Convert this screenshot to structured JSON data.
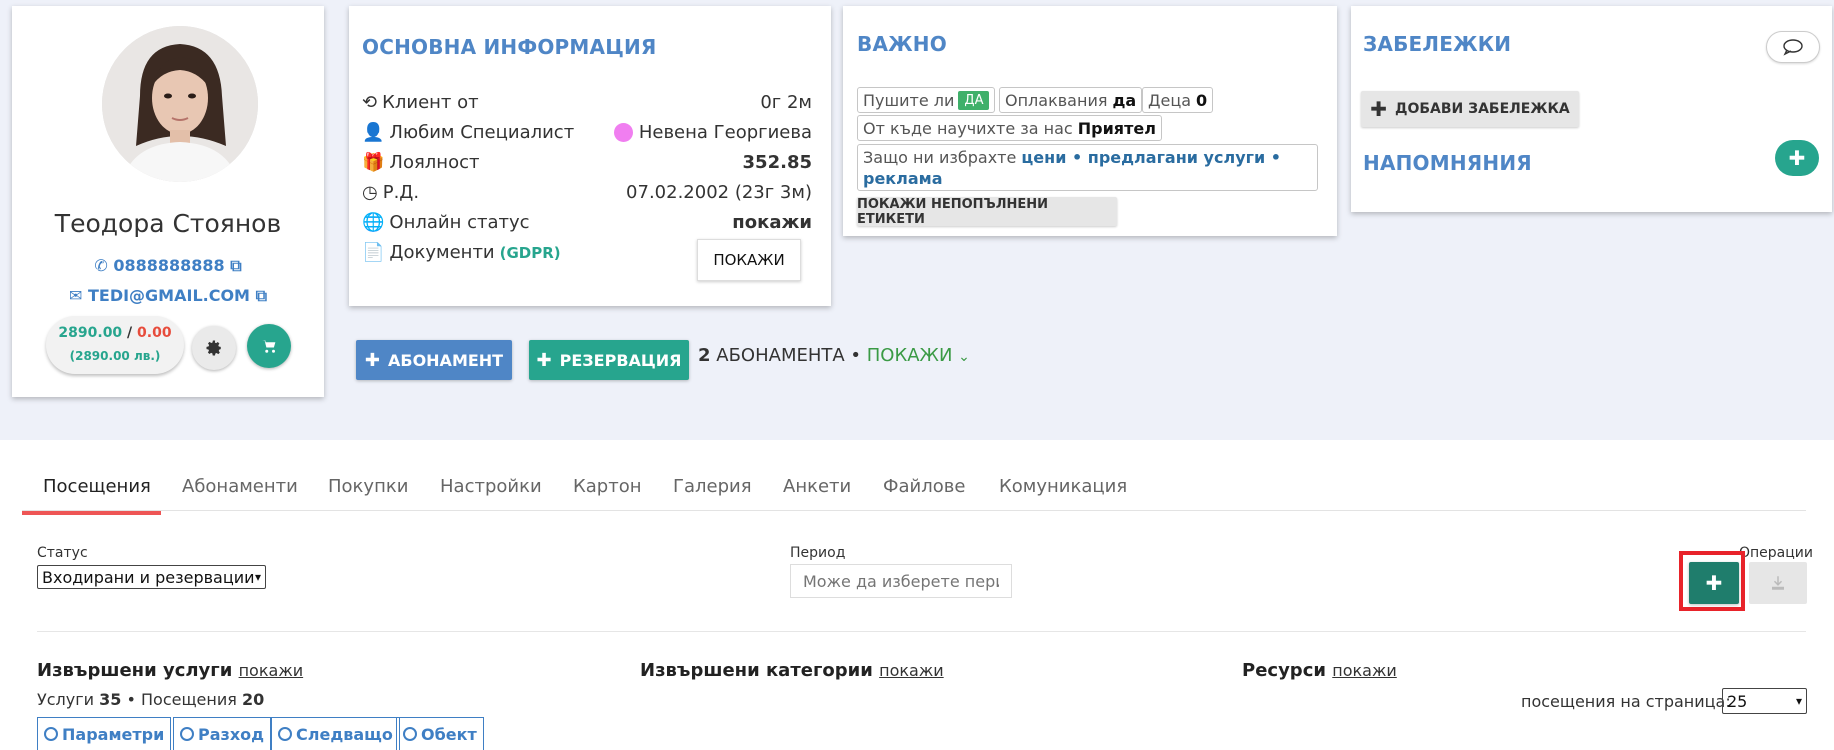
{
  "profile": {
    "name": "Теодора Стоянов",
    "phone": "0888888888",
    "email": "TEDI@GMAIL.COM",
    "balance_green": "2890.00",
    "balance_sep": " / ",
    "balance_red": "0.00",
    "balance_sub": "(2890.00 лв.)"
  },
  "basic_info": {
    "title": "ОСНОВНА ИНФОРМАЦИЯ",
    "rows": [
      {
        "label": "Клиент от",
        "value": "0г 2м"
      },
      {
        "label": "Любим Специалист",
        "value": "Невена Георгиева"
      },
      {
        "label": "Лоялност",
        "value": "352.85"
      },
      {
        "label": "Р.Д.",
        "value": "07.02.2002 (23г 3м)"
      },
      {
        "label": "Онлайн статус",
        "value": "покажи"
      },
      {
        "label": "Документи",
        "value": ""
      }
    ],
    "gdpr": "(GDPR)",
    "show_button": "ПОКАЖИ"
  },
  "important": {
    "title": "ВАЖНО",
    "smoke_label": "Пушите ли",
    "smoke_value": "ДА",
    "complaints_label": "Оплаквания",
    "complaints_value": "да",
    "kids_label": "Деца",
    "kids_value": "0",
    "source_label": "От къде научихте за нас",
    "source_value": "Приятел",
    "why_label": "Защо ни избрахте",
    "why_value_1": "цени • предлагани услуги •",
    "why_value_2": "реклама",
    "unfilled_button": "ПОКАЖИ НЕПОПЪЛНЕНИ ЕТИКЕТИ"
  },
  "notes": {
    "title": "ЗАБЕЛЕЖКИ",
    "add_button": "ДОБАВИ ЗАБЕЛЕЖКА",
    "reminders_title": "НАПОМНЯНИЯ"
  },
  "actions": {
    "subscription_button": "АБОНАМЕНТ",
    "reservation_button": "РЕЗЕРВАЦИЯ",
    "subs_count": "2",
    "subs_text": "АБОНАМЕНТА •",
    "subs_show": "ПОКАЖИ"
  },
  "tabs": [
    "Посещения",
    "Абонаменти",
    "Покупки",
    "Настройки",
    "Картон",
    "Галерия",
    "Анкети",
    "Файлове",
    "Комуникация"
  ],
  "filters": {
    "status_label": "Статус",
    "status_value": "Входирани и резервации",
    "period_label": "Период",
    "period_placeholder": "Може да изберете период",
    "operations_label": "Операции"
  },
  "summary": {
    "services_title": "Извършени услуги",
    "categories_title": "Извършени категории",
    "resources_title": "Ресурси",
    "show_link": "покажи",
    "services_label": "Услуги",
    "services_count": "35",
    "visits_label": "• Посещения",
    "visits_count": "20",
    "per_page_label": "посещения на страница:",
    "per_page_value": "25",
    "chips": [
      "Параметри",
      "Разход",
      "Следващо",
      "Обект"
    ]
  },
  "colors": {
    "accent_blue": "#4f86c6",
    "teal": "#27a58e",
    "tab_active_underline": "#ee5555",
    "highlight_box": "#e8232a"
  }
}
